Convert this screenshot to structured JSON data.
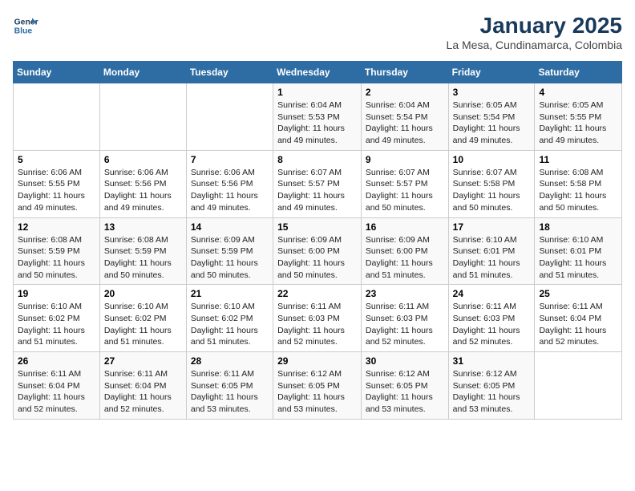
{
  "logo": {
    "line1": "General",
    "line2": "Blue"
  },
  "title": "January 2025",
  "subtitle": "La Mesa, Cundinamarca, Colombia",
  "weekdays": [
    "Sunday",
    "Monday",
    "Tuesday",
    "Wednesday",
    "Thursday",
    "Friday",
    "Saturday"
  ],
  "weeks": [
    [
      {
        "day": "",
        "sunrise": "",
        "sunset": "",
        "daylight": ""
      },
      {
        "day": "",
        "sunrise": "",
        "sunset": "",
        "daylight": ""
      },
      {
        "day": "",
        "sunrise": "",
        "sunset": "",
        "daylight": ""
      },
      {
        "day": "1",
        "sunrise": "Sunrise: 6:04 AM",
        "sunset": "Sunset: 5:53 PM",
        "daylight": "Daylight: 11 hours and 49 minutes."
      },
      {
        "day": "2",
        "sunrise": "Sunrise: 6:04 AM",
        "sunset": "Sunset: 5:54 PM",
        "daylight": "Daylight: 11 hours and 49 minutes."
      },
      {
        "day": "3",
        "sunrise": "Sunrise: 6:05 AM",
        "sunset": "Sunset: 5:54 PM",
        "daylight": "Daylight: 11 hours and 49 minutes."
      },
      {
        "day": "4",
        "sunrise": "Sunrise: 6:05 AM",
        "sunset": "Sunset: 5:55 PM",
        "daylight": "Daylight: 11 hours and 49 minutes."
      }
    ],
    [
      {
        "day": "5",
        "sunrise": "Sunrise: 6:06 AM",
        "sunset": "Sunset: 5:55 PM",
        "daylight": "Daylight: 11 hours and 49 minutes."
      },
      {
        "day": "6",
        "sunrise": "Sunrise: 6:06 AM",
        "sunset": "Sunset: 5:56 PM",
        "daylight": "Daylight: 11 hours and 49 minutes."
      },
      {
        "day": "7",
        "sunrise": "Sunrise: 6:06 AM",
        "sunset": "Sunset: 5:56 PM",
        "daylight": "Daylight: 11 hours and 49 minutes."
      },
      {
        "day": "8",
        "sunrise": "Sunrise: 6:07 AM",
        "sunset": "Sunset: 5:57 PM",
        "daylight": "Daylight: 11 hours and 49 minutes."
      },
      {
        "day": "9",
        "sunrise": "Sunrise: 6:07 AM",
        "sunset": "Sunset: 5:57 PM",
        "daylight": "Daylight: 11 hours and 50 minutes."
      },
      {
        "day": "10",
        "sunrise": "Sunrise: 6:07 AM",
        "sunset": "Sunset: 5:58 PM",
        "daylight": "Daylight: 11 hours and 50 minutes."
      },
      {
        "day": "11",
        "sunrise": "Sunrise: 6:08 AM",
        "sunset": "Sunset: 5:58 PM",
        "daylight": "Daylight: 11 hours and 50 minutes."
      }
    ],
    [
      {
        "day": "12",
        "sunrise": "Sunrise: 6:08 AM",
        "sunset": "Sunset: 5:59 PM",
        "daylight": "Daylight: 11 hours and 50 minutes."
      },
      {
        "day": "13",
        "sunrise": "Sunrise: 6:08 AM",
        "sunset": "Sunset: 5:59 PM",
        "daylight": "Daylight: 11 hours and 50 minutes."
      },
      {
        "day": "14",
        "sunrise": "Sunrise: 6:09 AM",
        "sunset": "Sunset: 5:59 PM",
        "daylight": "Daylight: 11 hours and 50 minutes."
      },
      {
        "day": "15",
        "sunrise": "Sunrise: 6:09 AM",
        "sunset": "Sunset: 6:00 PM",
        "daylight": "Daylight: 11 hours and 50 minutes."
      },
      {
        "day": "16",
        "sunrise": "Sunrise: 6:09 AM",
        "sunset": "Sunset: 6:00 PM",
        "daylight": "Daylight: 11 hours and 51 minutes."
      },
      {
        "day": "17",
        "sunrise": "Sunrise: 6:10 AM",
        "sunset": "Sunset: 6:01 PM",
        "daylight": "Daylight: 11 hours and 51 minutes."
      },
      {
        "day": "18",
        "sunrise": "Sunrise: 6:10 AM",
        "sunset": "Sunset: 6:01 PM",
        "daylight": "Daylight: 11 hours and 51 minutes."
      }
    ],
    [
      {
        "day": "19",
        "sunrise": "Sunrise: 6:10 AM",
        "sunset": "Sunset: 6:02 PM",
        "daylight": "Daylight: 11 hours and 51 minutes."
      },
      {
        "day": "20",
        "sunrise": "Sunrise: 6:10 AM",
        "sunset": "Sunset: 6:02 PM",
        "daylight": "Daylight: 11 hours and 51 minutes."
      },
      {
        "day": "21",
        "sunrise": "Sunrise: 6:10 AM",
        "sunset": "Sunset: 6:02 PM",
        "daylight": "Daylight: 11 hours and 51 minutes."
      },
      {
        "day": "22",
        "sunrise": "Sunrise: 6:11 AM",
        "sunset": "Sunset: 6:03 PM",
        "daylight": "Daylight: 11 hours and 52 minutes."
      },
      {
        "day": "23",
        "sunrise": "Sunrise: 6:11 AM",
        "sunset": "Sunset: 6:03 PM",
        "daylight": "Daylight: 11 hours and 52 minutes."
      },
      {
        "day": "24",
        "sunrise": "Sunrise: 6:11 AM",
        "sunset": "Sunset: 6:03 PM",
        "daylight": "Daylight: 11 hours and 52 minutes."
      },
      {
        "day": "25",
        "sunrise": "Sunrise: 6:11 AM",
        "sunset": "Sunset: 6:04 PM",
        "daylight": "Daylight: 11 hours and 52 minutes."
      }
    ],
    [
      {
        "day": "26",
        "sunrise": "Sunrise: 6:11 AM",
        "sunset": "Sunset: 6:04 PM",
        "daylight": "Daylight: 11 hours and 52 minutes."
      },
      {
        "day": "27",
        "sunrise": "Sunrise: 6:11 AM",
        "sunset": "Sunset: 6:04 PM",
        "daylight": "Daylight: 11 hours and 52 minutes."
      },
      {
        "day": "28",
        "sunrise": "Sunrise: 6:11 AM",
        "sunset": "Sunset: 6:05 PM",
        "daylight": "Daylight: 11 hours and 53 minutes."
      },
      {
        "day": "29",
        "sunrise": "Sunrise: 6:12 AM",
        "sunset": "Sunset: 6:05 PM",
        "daylight": "Daylight: 11 hours and 53 minutes."
      },
      {
        "day": "30",
        "sunrise": "Sunrise: 6:12 AM",
        "sunset": "Sunset: 6:05 PM",
        "daylight": "Daylight: 11 hours and 53 minutes."
      },
      {
        "day": "31",
        "sunrise": "Sunrise: 6:12 AM",
        "sunset": "Sunset: 6:05 PM",
        "daylight": "Daylight: 11 hours and 53 minutes."
      },
      {
        "day": "",
        "sunrise": "",
        "sunset": "",
        "daylight": ""
      }
    ]
  ]
}
